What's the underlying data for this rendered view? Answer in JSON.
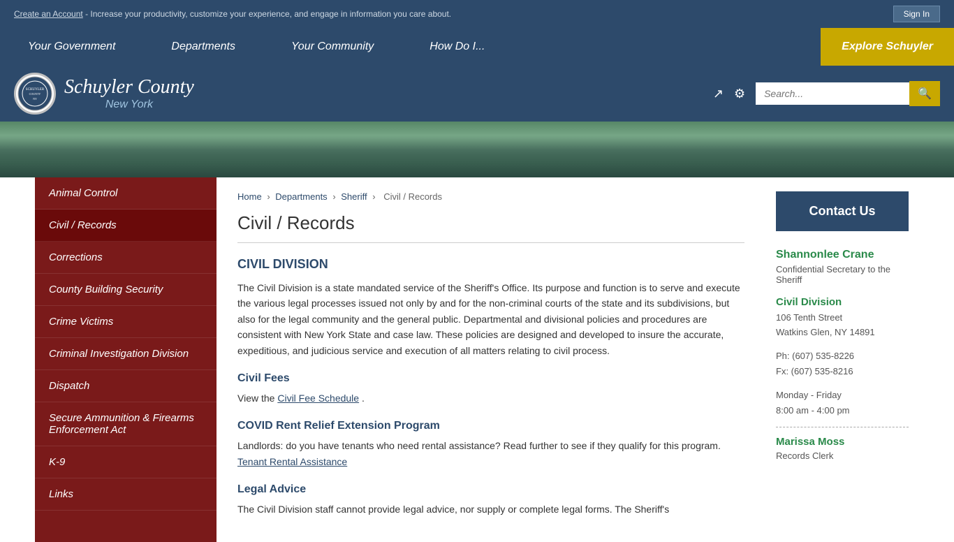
{
  "topBanner": {
    "text": "Create an Account",
    "description": " - Increase your productivity, customize your experience, and engage in information you care about.",
    "signInLabel": "Sign In"
  },
  "nav": {
    "items": [
      {
        "label": "Your Government"
      },
      {
        "label": "Departments"
      },
      {
        "label": "Your Community"
      },
      {
        "label": "How Do I..."
      },
      {
        "label": "Explore Schuyler"
      }
    ]
  },
  "header": {
    "siteName": "Schuyler County",
    "stateLabel": "New York",
    "searchPlaceholder": "Search..."
  },
  "sidebar": {
    "items": [
      {
        "label": "Animal Control"
      },
      {
        "label": "Civil / Records"
      },
      {
        "label": "Corrections"
      },
      {
        "label": "County Building Security"
      },
      {
        "label": "Crime Victims"
      },
      {
        "label": "Criminal Investigation Division"
      },
      {
        "label": "Dispatch"
      },
      {
        "label": "Secure Ammunition & Firearms Enforcement Act"
      },
      {
        "label": "K-9"
      },
      {
        "label": "Links"
      }
    ]
  },
  "breadcrumb": {
    "items": [
      "Home",
      "Departments",
      "Sheriff",
      "Civil / Records"
    ]
  },
  "page": {
    "title": "Civil / Records",
    "sections": [
      {
        "heading": "CIVIL DIVISION",
        "content": "The Civil Division is a state mandated service of the Sheriff's Office. Its purpose and function is to serve and execute the various legal processes issued not only by and for the non-criminal courts of the state and its subdivisions, but also for the legal community and the general public. Departmental and divisional policies and procedures are consistent with New York State and case law. These policies are designed and developed to insure the accurate, expeditious, and judicious service and execution of all matters relating to civil process."
      },
      {
        "heading": "Civil Fees",
        "content": "View the ",
        "linkText": "Civil Fee Schedule",
        "contentAfter": "."
      },
      {
        "heading": "COVID Rent Relief Extension Program",
        "content": "Landlords: do you have tenants who need rental assistance?  Read further to see if they qualify for this program.  ",
        "linkText": "Tenant Rental Assistance"
      },
      {
        "heading": "Legal Advice",
        "content": "The Civil Division staff cannot provide legal advice, nor supply or complete legal forms. The Sheriff's"
      }
    ]
  },
  "rightPanel": {
    "contactUsLabel": "Contact Us",
    "contacts": [
      {
        "name": "Shannonlee Crane",
        "title": "Confidential Secretary to the Sheriff"
      }
    ],
    "division": {
      "name": "Civil Division",
      "address1": "106 Tenth Street",
      "address2": " Watkins Glen, NY 14891",
      "phone": "Ph: (607) 535-8226",
      "fax": "Fx: (607) 535-8216",
      "hoursLabel": "Monday - Friday",
      "hours": "8:00 am - 4:00 pm"
    },
    "contact2": {
      "name": "Marissa Moss",
      "title": "Records Clerk"
    }
  }
}
